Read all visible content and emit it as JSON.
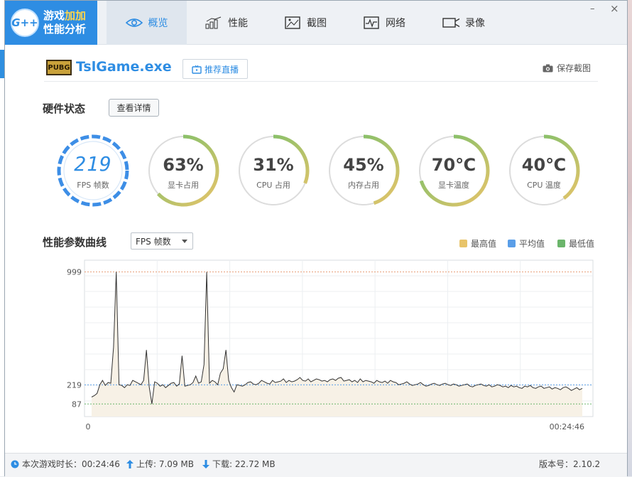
{
  "app": {
    "logo_badge": "G++",
    "logo_line1a": "游戏",
    "logo_line1b": "加加",
    "logo_line2": "性能分析"
  },
  "tabs": [
    {
      "label": "概览",
      "icon": "eye-icon",
      "active": true
    },
    {
      "label": "性能",
      "icon": "bar-chart-icon",
      "active": false
    },
    {
      "label": "截图",
      "icon": "image-icon",
      "active": false
    },
    {
      "label": "网络",
      "icon": "pulse-icon",
      "active": false
    },
    {
      "label": "录像",
      "icon": "video-camera-icon",
      "active": false
    }
  ],
  "window_controls": {
    "minimize": "–",
    "close": "×"
  },
  "header": {
    "game_badge": "PUBG",
    "game_title": "TslGame.exe",
    "recommend_label": "推荐直播",
    "save_label": "保存截图"
  },
  "hardware": {
    "title": "硬件状态",
    "detail_button": "查看详情",
    "gauges": [
      {
        "value": "219",
        "label": "FPS 帧数",
        "fraction": 1.0,
        "kind": "fps"
      },
      {
        "value": "63%",
        "label": "显卡占用",
        "fraction": 0.63
      },
      {
        "value": "31%",
        "label": "CPU 占用",
        "fraction": 0.31
      },
      {
        "value": "45%",
        "label": "内存占用",
        "fraction": 0.45
      },
      {
        "value": "70℃",
        "label": "显卡温度",
        "fraction": 0.7
      },
      {
        "value": "40℃",
        "label": "CPU 温度",
        "fraction": 0.4
      }
    ]
  },
  "curve": {
    "title": "性能参数曲线",
    "selected": "FPS 帧数",
    "legend": [
      {
        "label": "最高值",
        "color": "#e8c46a"
      },
      {
        "label": "平均值",
        "color": "#5a9ee8"
      },
      {
        "label": "最低值",
        "color": "#6bb56b"
      }
    ]
  },
  "chart_data": {
    "type": "line",
    "x_start_label": "0",
    "x_end_label": "00:24:46",
    "y_ticks": [
      "999",
      "219",
      "87"
    ],
    "max": 999,
    "avg": 219,
    "min": 87,
    "series": [
      {
        "values": [
          135,
          145,
          160,
          220,
          250,
          215,
          235,
          230,
          480,
          999,
          220,
          215,
          200,
          220,
          215,
          250,
          240,
          230,
          220,
          250,
          460,
          205,
          87,
          240,
          230,
          210,
          220,
          200,
          215,
          230,
          235,
          210,
          225,
          420,
          210,
          215,
          220,
          235,
          280,
          230,
          240,
          360,
          999,
          230,
          250,
          240,
          220,
          300,
          330,
          460,
          250,
          200,
          170,
          220,
          215,
          210,
          220,
          235,
          240,
          225,
          220,
          230,
          250,
          240,
          230,
          225,
          250,
          235,
          240,
          245,
          260,
          235,
          250,
          240,
          245,
          255,
          270,
          250,
          245,
          260,
          240,
          250,
          260,
          255,
          245,
          250,
          240,
          255,
          260,
          250,
          265,
          270,
          245,
          250,
          255,
          240,
          250,
          235,
          260,
          240,
          250,
          245,
          240,
          230,
          250,
          240,
          235,
          245,
          230,
          250,
          240,
          235,
          220,
          225,
          230,
          240,
          225,
          215,
          220,
          225,
          235,
          220,
          210,
          215,
          225,
          230,
          220,
          215,
          225,
          230,
          220,
          215,
          225,
          220,
          210,
          215,
          220,
          225,
          210,
          205,
          215,
          220,
          225,
          215,
          210,
          220,
          205,
          210,
          220,
          215,
          205,
          210,
          200,
          215,
          205,
          210,
          200,
          195,
          210,
          205,
          215,
          200,
          195,
          205,
          210,
          195,
          200,
          205,
          190,
          200,
          195,
          185,
          200,
          205,
          195,
          180,
          190,
          200,
          185,
          195
        ]
      }
    ]
  },
  "status": {
    "duration": "本次游戏时长：00:24:46",
    "upload": "上传: 7.09 MB",
    "download": "下载: 22.72 MB",
    "version": "版本号：2.10.2"
  }
}
